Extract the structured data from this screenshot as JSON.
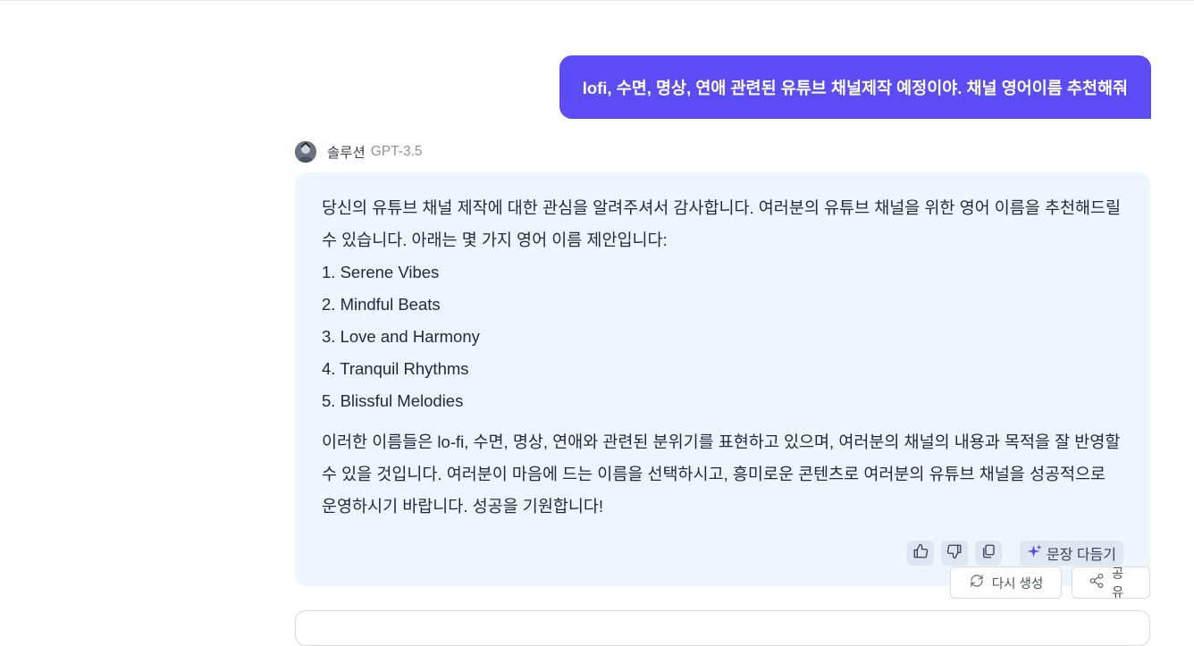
{
  "user_message": "lofi, 수면, 명상, 연애 관련된 유튜브 채널제작 예정이야. 채널 영어이름 추천해줘",
  "bot": {
    "name": "솔루션",
    "model": "GPT-3.5"
  },
  "answer": {
    "intro": "당신의 유튜브 채널 제작에 대한 관심을 알려주셔서 감사합니다. 여러분의 유튜브 채널을 위한 영어 이름을 추천해드릴 수 있습니다. 아래는 몇 가지 영어 이름 제안입니다:",
    "list": [
      "1. Serene Vibes",
      "2. Mindful Beats",
      "3. Love and Harmony",
      "4. Tranquil Rhythms",
      "5. Blissful Melodies"
    ],
    "outro": "이러한 이름들은 lo-fi, 수면, 명상, 연애와 관련된 분위기를 표현하고 있으며, 여러분의 채널의 내용과 목적을 잘 반영할 수 있을 것입니다. 여러분이 마음에 드는 이름을 선택하시고, 흥미로운 콘텐츠로 여러분의 유튜브 채널을 성공적으로 운영하시기 바랍니다. 성공을 기원합니다!"
  },
  "actions": {
    "polish": "문장 다듬기",
    "regenerate": "다시 생성",
    "share": "공유"
  },
  "icons": {
    "like": "thumbs-up-icon",
    "dislike": "thumbs-down-icon",
    "copy": "copy-icon",
    "polish": "sparkle-icon",
    "regenerate": "refresh-icon",
    "share": "share-icon"
  },
  "colors": {
    "user_bubble": "#5b4cf5",
    "answer_bg": "#eff5ff",
    "sparkle": "#5b4cf5"
  }
}
